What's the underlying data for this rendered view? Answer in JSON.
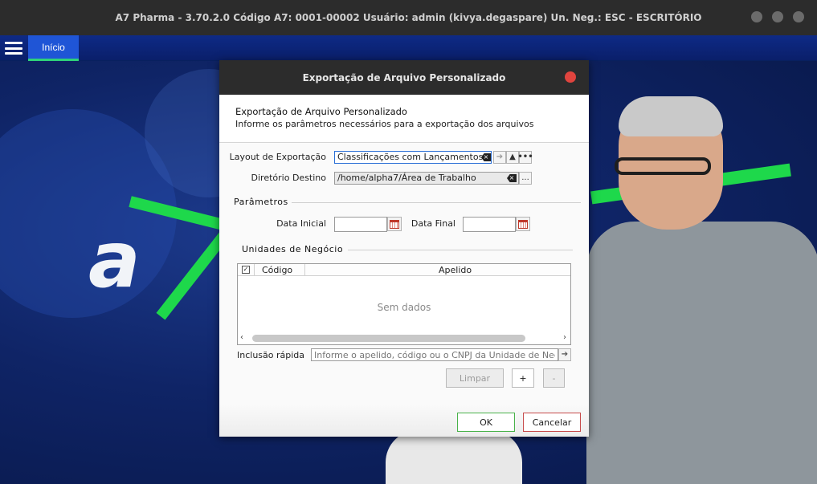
{
  "window": {
    "title": "A7 Pharma - 3.70.2.0   Código A7: 0001-00002   Usuário: admin (kivya.degaspare)   Un. Neg.: ESC - ESCRITÓRIO"
  },
  "menubar": {
    "tab_label": "Início"
  },
  "dialog": {
    "title": "Exportação de Arquivo Personalizado",
    "header_title": "Exportação de Arquivo Personalizado",
    "header_subtitle": "Informe os parâmetros necessários para a exportação dos arquivos",
    "layout_label": "Layout de Exportação",
    "layout_value": "Classificações com Lançamentos",
    "dir_label": "Diretório Destino",
    "dir_value": "/home/alpha7/Área de Trabalho",
    "params_title": "Parâmetros",
    "data_inicial_label": "Data Inicial",
    "data_final_label": "Data Final",
    "data_inicial_value": "",
    "data_final_value": "",
    "unidades_title": "Unidades de Negócio",
    "table": {
      "columns": [
        "Código",
        "Apelido"
      ],
      "empty_text": "Sem dados"
    },
    "inclusao_label": "Inclusão rápida",
    "inclusao_placeholder": "Informe o apelido, código ou o CNPJ da Unidade de Negócio",
    "limpar_label": "Limpar",
    "add_label": "+",
    "remove_label": "-",
    "ok_label": "OK",
    "cancel_label": "Cancelar"
  },
  "colors": {
    "accent_green": "#1ed84b",
    "menubar_blue": "#0e2a86",
    "tab_blue": "#1f55d6",
    "close_red": "#e0443e"
  },
  "icons": {
    "menu": "hamburger-icon",
    "clear": "clear-icon",
    "arrow": "arrow-right-icon",
    "up": "triangle-up-icon",
    "more": "ellipsis-icon",
    "calendar": "calendar-icon"
  }
}
